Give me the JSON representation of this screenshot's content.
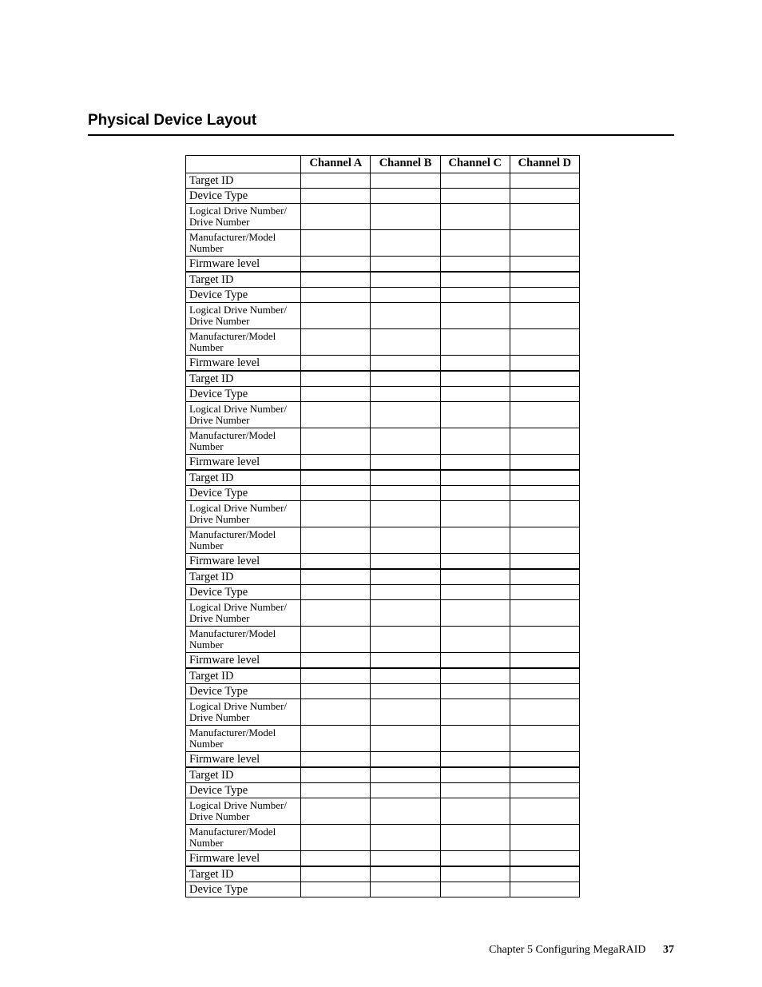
{
  "heading": "Physical Device Layout",
  "columns": [
    "Channel A",
    "Channel B",
    "Channel C",
    "Channel D"
  ],
  "rowLabels": {
    "targetId": "Target ID",
    "deviceType": "Device Type",
    "logicalDrive": "Logical Drive Number/ Drive Number",
    "mfgModel": "Manufacturer/Model Number",
    "firmware": "Firmware level"
  },
  "groupCount": 7,
  "tailRows": [
    "targetId",
    "deviceType"
  ],
  "footer": {
    "text": "Chapter 5 Configuring MegaRAID",
    "page": "37"
  }
}
